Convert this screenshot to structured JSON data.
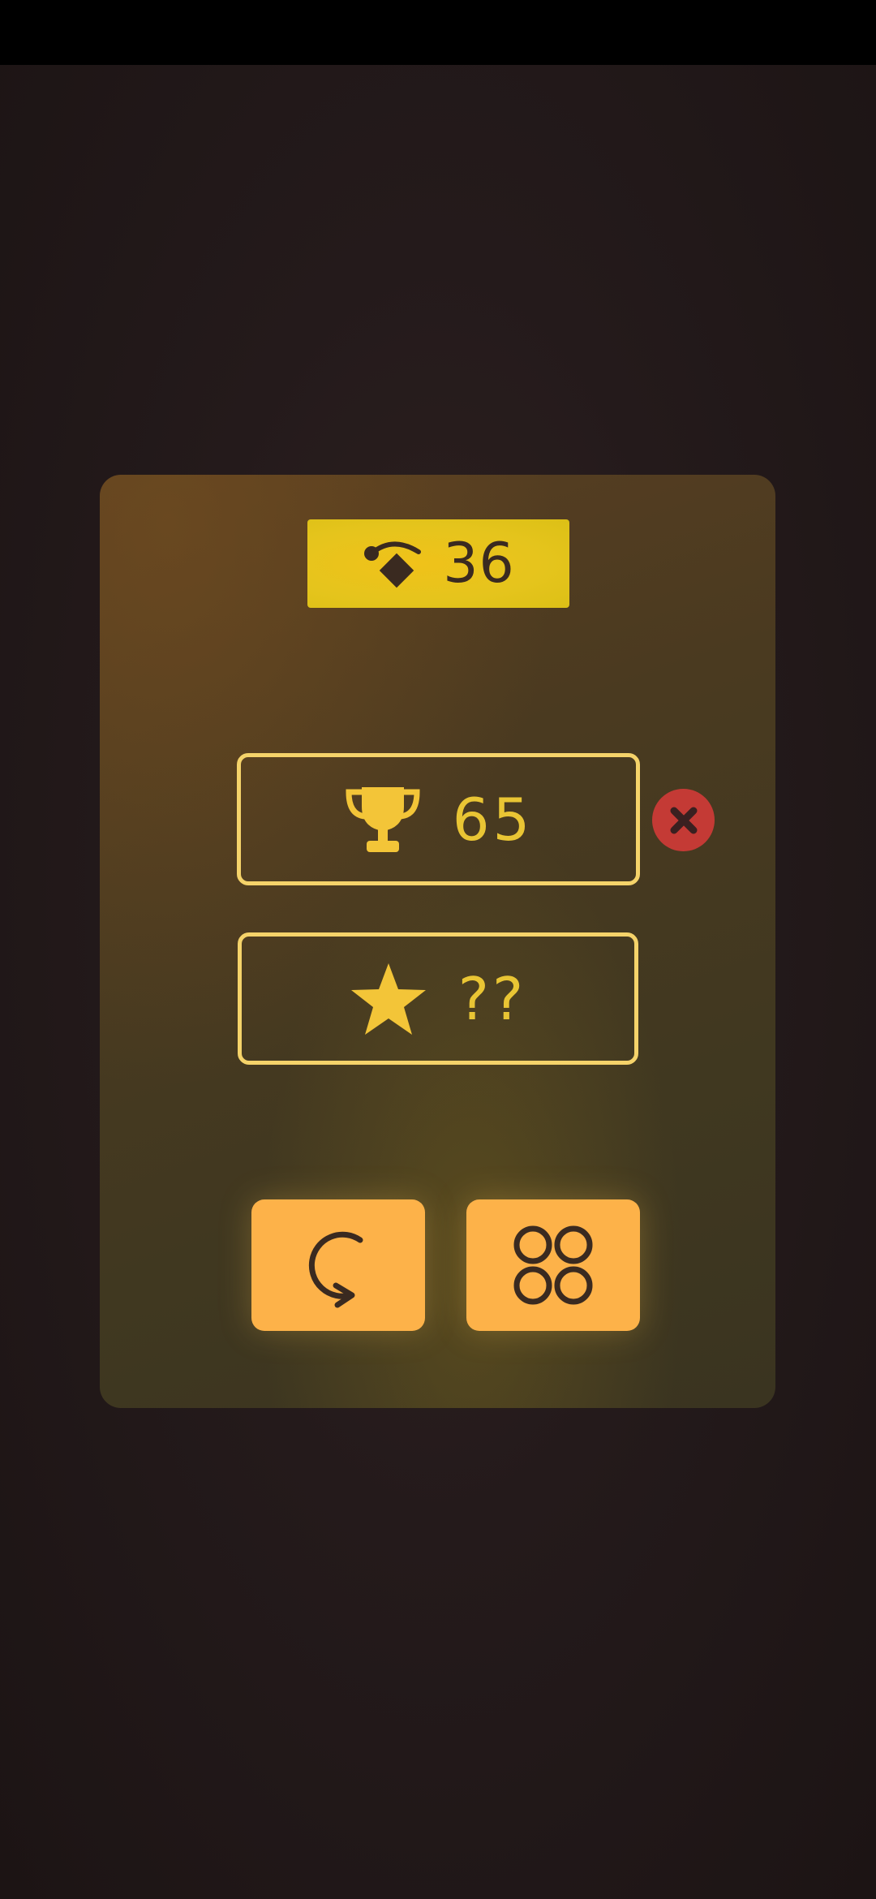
{
  "moves": {
    "value": "36",
    "icon": "swap-move-icon"
  },
  "best_score": {
    "value": "65",
    "icon": "trophy-icon"
  },
  "target_score": {
    "value": "??",
    "icon": "star-icon"
  },
  "buttons": {
    "reset_icon": "close-icon",
    "restart_icon": "restart-icon",
    "levels_icon": "levels-grid-icon"
  },
  "colors": {
    "accent_yellow": "#e9c534",
    "badge_yellow": "#e5c41c",
    "button_orange": "#fdb249",
    "danger_red": "#c43a35",
    "icon_dark": "#3a2a20"
  }
}
